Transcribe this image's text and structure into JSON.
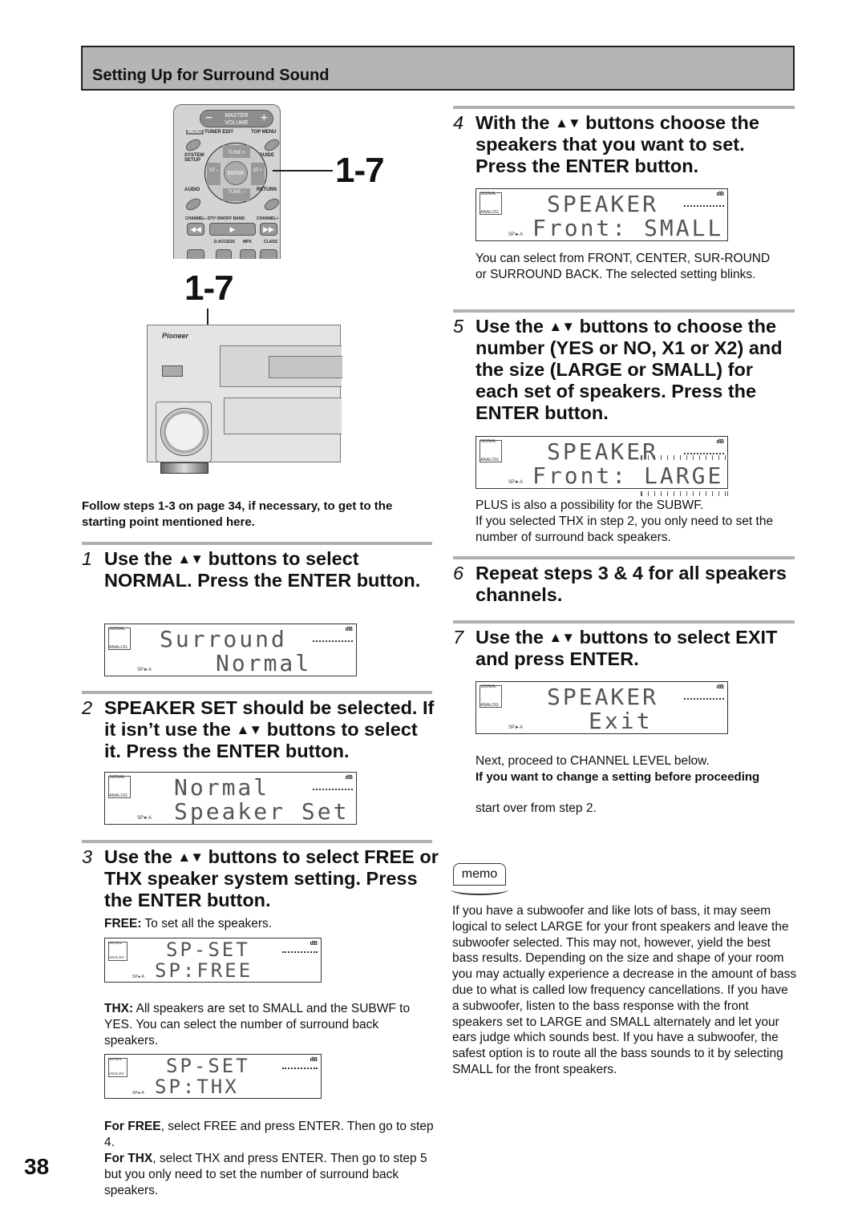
{
  "header": {
    "title": "Setting Up for Surround Sound"
  },
  "remote": {
    "master_volume": "MASTER\nVOLUME",
    "vol_minus": "−",
    "vol_plus": "+",
    "labels": {
      "menu": "MENU",
      "tuner_edit": "TUNER EDIT",
      "top_menu": "TOP MENU",
      "system_setup": "SYSTEM SETUP",
      "guide": "GUIDE",
      "tune_plus": "TUNE +",
      "tune_minus": "TUNE −",
      "st_minus": "ST−",
      "st_plus": "ST+",
      "enter": "ENTER",
      "audio": "AUDIO",
      "return": "RETURN",
      "channel_minus": "CHANNEL−",
      "dtv": "DTV  ON/OFF  BAND",
      "channel_plus": "CHANNEL+",
      "d_access": "D.ACCESS",
      "mpx": "MPX",
      "class": "CLASS"
    },
    "callout": "1-7"
  },
  "receiver": {
    "brand": "Pioneer",
    "callout": "1-7"
  },
  "intro_note": "Follow steps 1-3 on page 34, if necessary, to get to the starting point mentioned here.",
  "arrows": "▲▼",
  "lcd_common": {
    "signal": "SIGNAL",
    "analog": "ANALOG",
    "db": "dB",
    "sp": "SP►A"
  },
  "steps": [
    {
      "num": "1",
      "pre": "Use the ",
      "post": " buttons to select NORMAL. Press the ENTER button.",
      "lcd": {
        "line1": "Surround",
        "line2": "Normal"
      }
    },
    {
      "num": "2",
      "pre": "SPEAKER SET should be selected. If it isn’t use the ",
      "post": " buttons to select it. Press the ENTER button.",
      "lcd": {
        "line1": "Normal",
        "line2": "Speaker Set"
      }
    },
    {
      "num": "3",
      "pre": "Use the ",
      "post": " buttons to select FREE or THX speaker system setting. Press the ENTER button.",
      "free_label": "FREE:",
      "free_text": " To set all the speakers.",
      "lcd_free": {
        "line1": "SP-SET",
        "line2": "SP:FREE"
      },
      "thx_label": "THX:",
      "thx_text": " All speakers are set to SMALL and the SUBWF to YES. You can select the number of surround back speakers.",
      "lcd_thx": {
        "line1": "SP-SET",
        "line2": "SP:THX"
      },
      "for_free_label": "For FREE",
      "for_free_text": ", select FREE and press ENTER. Then go to step 4.",
      "for_thx_label": "For THX",
      "for_thx_text": ", select THX and press ENTER. Then go to step 5 but you only need to set the number of surround back speakers."
    },
    {
      "num": "4",
      "pre": "With the ",
      "post": " buttons choose the speakers that you want to set. Press the ENTER button.",
      "lcd": {
        "line1": "SPEAKER",
        "line2_prefix": "Front: ",
        "line2_value": "SMALL"
      },
      "note": "You can select from FRONT, CENTER, SUR-ROUND or SURROUND BACK. The selected setting blinks."
    },
    {
      "num": "5",
      "pre": "Use the ",
      "post": " buttons to choose the  number (YES or NO, X1 or X2) and the size (LARGE or SMALL) for each set of speakers. Press the ENTER button.",
      "lcd": {
        "line1": "SPEAKER",
        "line2_prefix": "Front: ",
        "line2_value": "LARGE"
      },
      "note1": "PLUS is also a possibility for the SUBWF.",
      "note2": "If you selected THX in step 2, you only need to set the number of surround back speakers."
    },
    {
      "num": "6",
      "text": "Repeat steps 3 & 4 for all speakers channels."
    },
    {
      "num": "7",
      "pre": "Use the ",
      "post": " buttons to select EXIT and press ENTER.",
      "lcd": {
        "line1": "SPEAKER",
        "line2": "Exit"
      },
      "note": "Next, proceed to CHANNEL LEVEL below.",
      "bold_note": "If you want to change a setting before proceeding",
      "note_after": "start over from step 2."
    }
  ],
  "memo": {
    "label": "memo",
    "text": "If you have a subwoofer and like lots of bass, it may seem logical to select LARGE for your front speakers and leave the subwoofer selected. This may not, however, yield the best bass results. Depending on the size and shape of your room you may actually experience a decrease in the amount of bass due to what is called low frequency cancellations. If you have a subwoofer, listen to the bass response with the front speakers set to LARGE and SMALL alternately and let your ears judge which sounds best. If you have a subwoofer, the safest option is to route all the bass sounds to it by selecting SMALL for the front speakers."
  },
  "page_number": "38"
}
